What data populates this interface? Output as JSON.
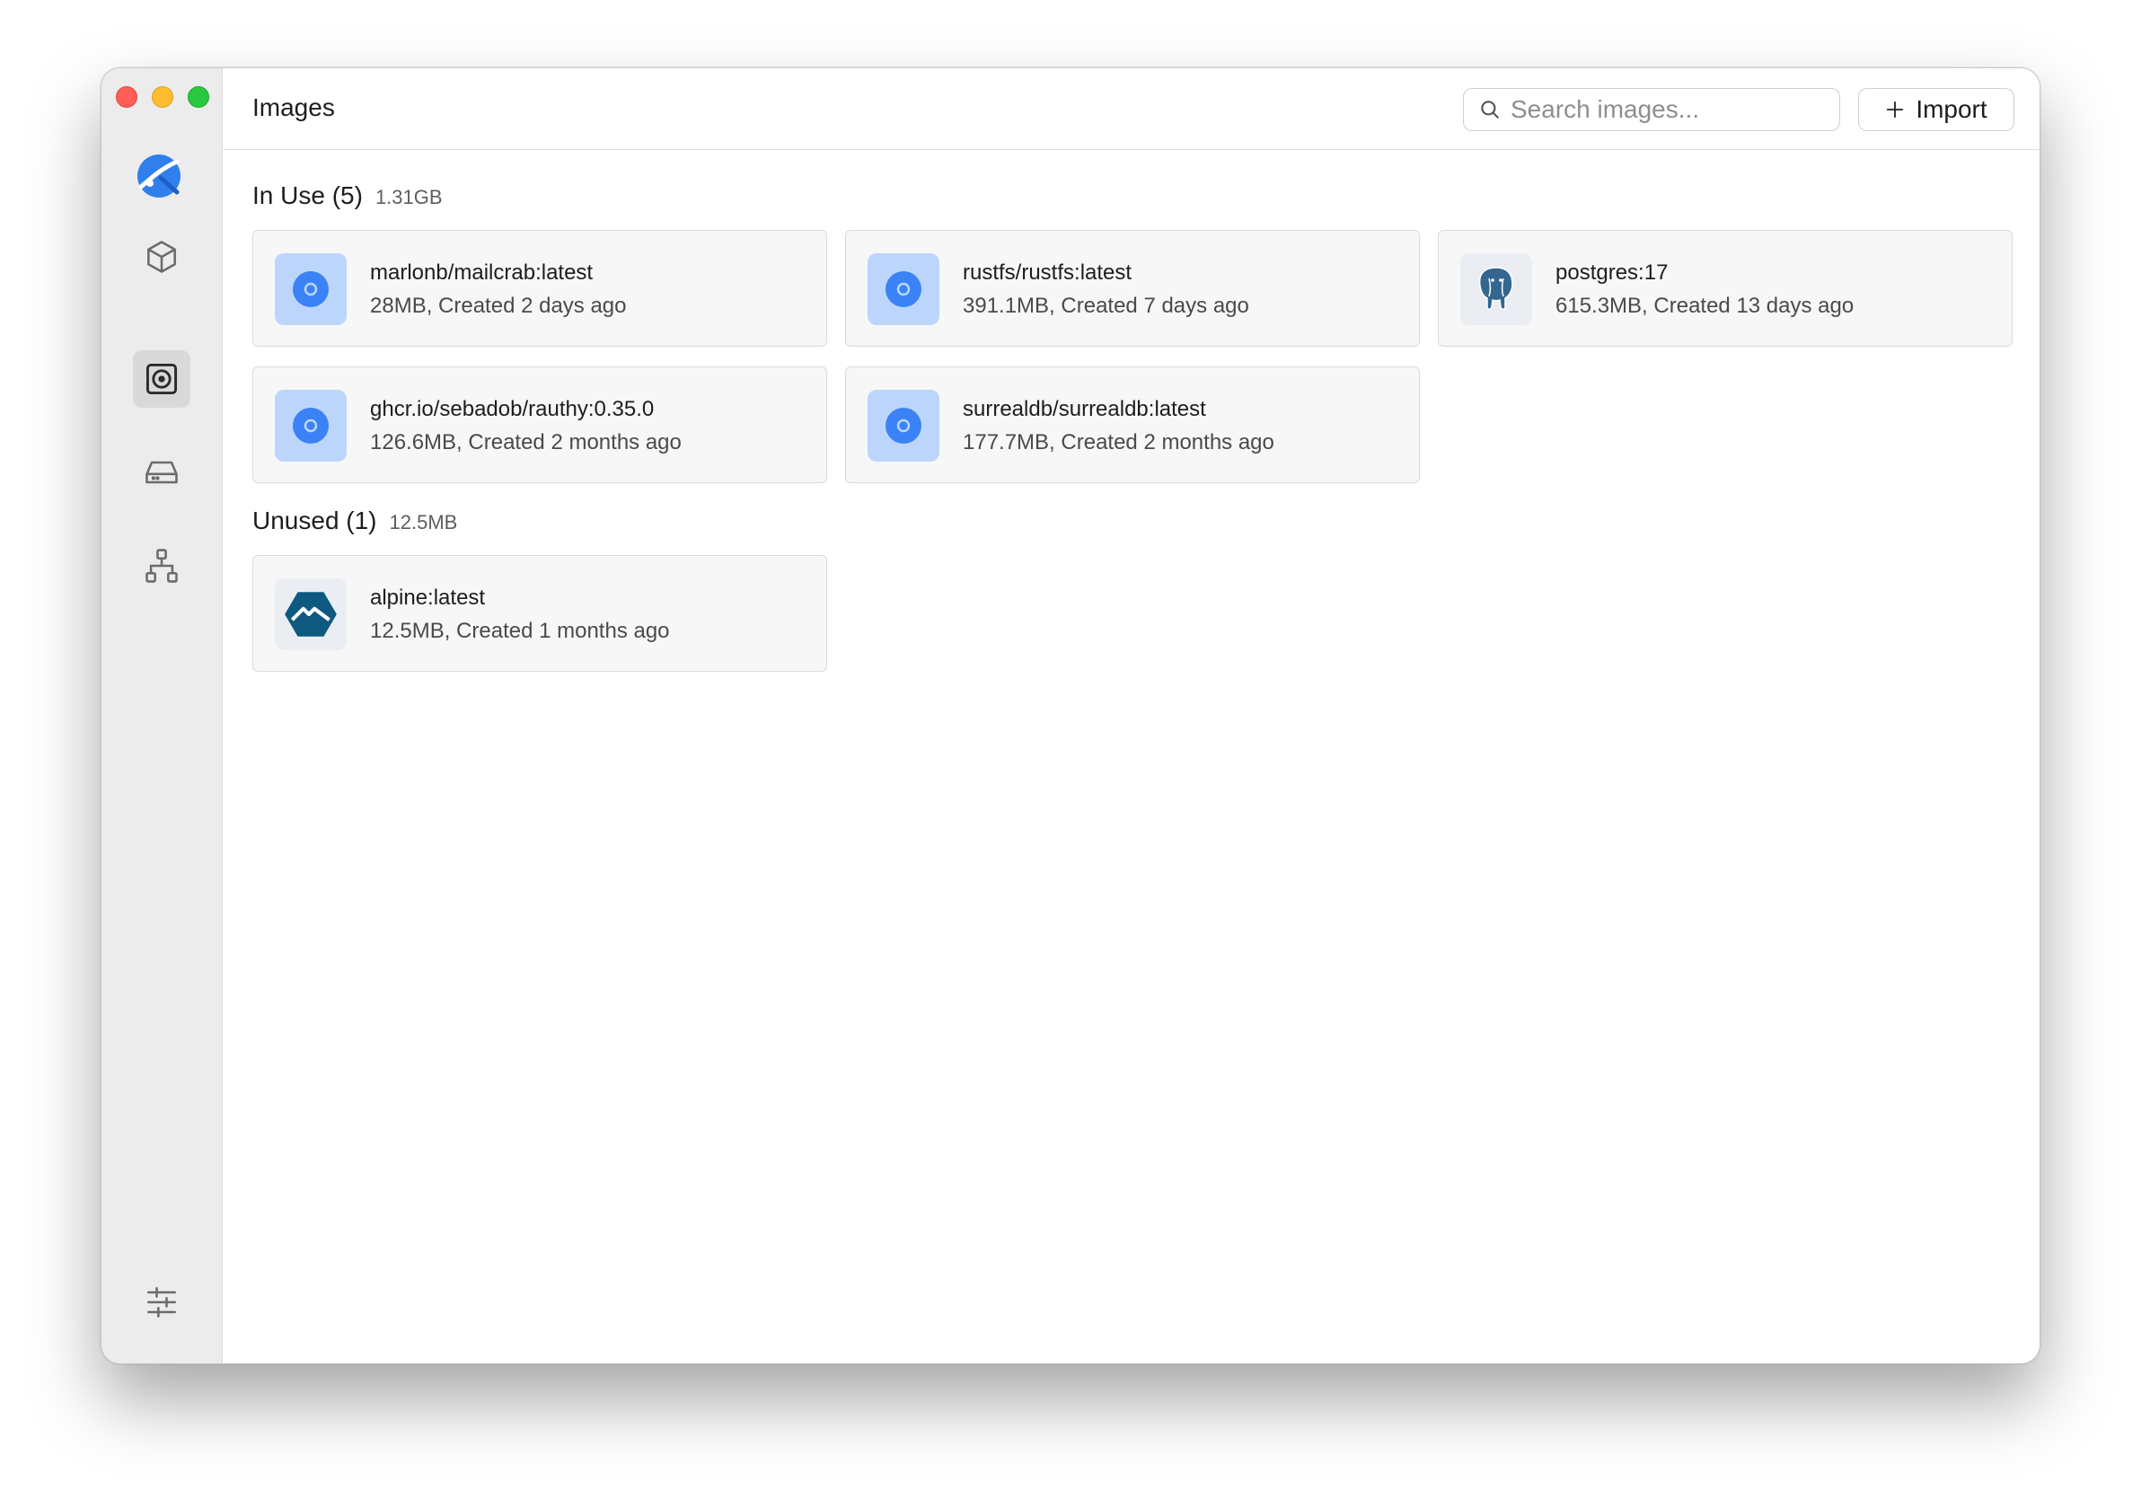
{
  "app": {
    "title": "Images"
  },
  "search": {
    "placeholder": "Search images..."
  },
  "toolbar": {
    "import_label": "Import"
  },
  "sections": {
    "in_use": {
      "label": "In Use (5)",
      "size": "1.31GB",
      "images": [
        {
          "name": "marlonb/mailcrab:latest",
          "meta": "28MB, Created 2 days ago",
          "icon": "disc-icon"
        },
        {
          "name": "rustfs/rustfs:latest",
          "meta": "391.1MB, Created 7 days ago",
          "icon": "disc-icon"
        },
        {
          "name": "postgres:17",
          "meta": "615.3MB, Created 13 days ago",
          "icon": "postgresql-logo-icon"
        },
        {
          "name": "ghcr.io/sebadob/rauthy:0.35.0",
          "meta": "126.6MB, Created 2 months ago",
          "icon": "disc-icon"
        },
        {
          "name": "surrealdb/surrealdb:latest",
          "meta": "177.7MB, Created 2 months ago",
          "icon": "disc-icon"
        }
      ]
    },
    "unused": {
      "label": "Unused (1)",
      "size": "12.5MB",
      "images": [
        {
          "name": "alpine:latest",
          "meta": "12.5MB, Created 1 months ago",
          "icon": "alpine-logo-icon"
        }
      ]
    }
  },
  "sidebar": {
    "items": [
      {
        "name": "containers",
        "icon": "cube-icon",
        "active": false
      },
      {
        "name": "images",
        "icon": "image-disc-icon",
        "active": true
      },
      {
        "name": "volumes",
        "icon": "drive-icon",
        "active": false
      },
      {
        "name": "networks",
        "icon": "network-icon",
        "active": false
      },
      {
        "name": "settings",
        "icon": "sliders-icon",
        "active": false
      }
    ]
  },
  "colors": {
    "accent": "#3b82f6",
    "icon_bg": "#bcd6fb",
    "close": "#ff5f57",
    "minimize": "#febc2e",
    "zoom": "#28c840"
  }
}
